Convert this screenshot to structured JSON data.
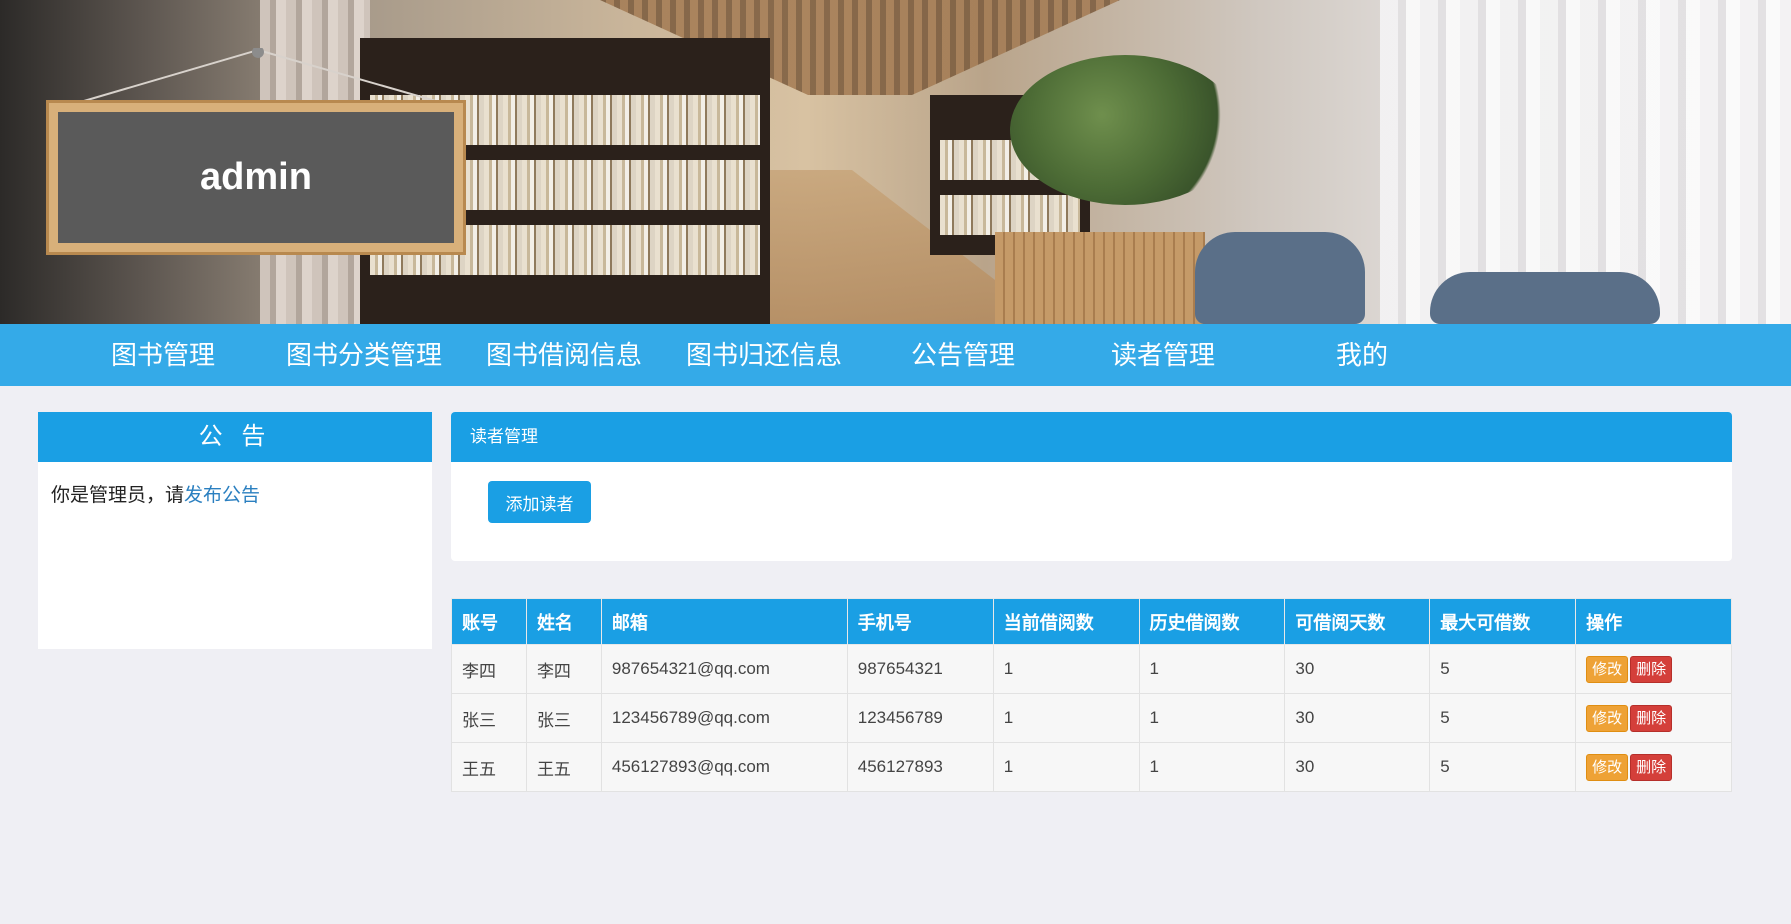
{
  "banner": {
    "sign_text": "admin"
  },
  "nav": {
    "items": [
      {
        "label": "图书管理"
      },
      {
        "label": "图书分类管理"
      },
      {
        "label": "图书借阅信息"
      },
      {
        "label": "图书归还信息"
      },
      {
        "label": "公告管理"
      },
      {
        "label": "读者管理"
      },
      {
        "label": "我的"
      }
    ]
  },
  "notice": {
    "title": "公 告",
    "text": "你是管理员，请",
    "link": "发布公告"
  },
  "main": {
    "title": "读者管理",
    "add_button": "添加读者",
    "table": {
      "headers": [
        "账号",
        "姓名",
        "邮箱",
        "手机号",
        "当前借阅数",
        "历史借阅数",
        "可借阅天数",
        "最大可借数",
        "操作"
      ],
      "rows": [
        {
          "account": "李四",
          "name": "李四",
          "email": "987654321@qq.com",
          "phone": "987654321",
          "current": "1",
          "history": "1",
          "days": "30",
          "max": "5"
        },
        {
          "account": "张三",
          "name": "张三",
          "email": "123456789@qq.com",
          "phone": "123456789",
          "current": "1",
          "history": "1",
          "days": "30",
          "max": "5"
        },
        {
          "account": "王五",
          "name": "王五",
          "email": "456127893@qq.com",
          "phone": "456127893",
          "current": "1",
          "history": "1",
          "days": "30",
          "max": "5"
        }
      ],
      "edit_label": "修改",
      "delete_label": "删除"
    }
  },
  "colors": {
    "primary": "#1a9fe4",
    "edit": "#eea236",
    "delete": "#d43f3a",
    "background": "#efeff4"
  }
}
